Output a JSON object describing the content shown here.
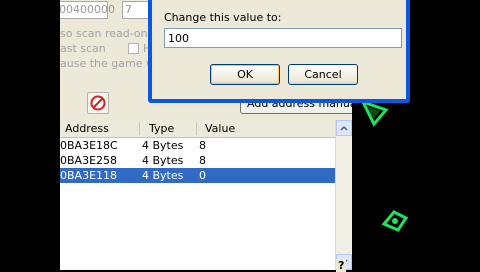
{
  "window": {
    "address_field_value": "00400000",
    "small_field_value": "7",
    "option_scan_readonly": "so scan read-only m",
    "option_fast_scan": "ast scan",
    "option_fast_scan_hex": "H",
    "option_pause_game": "ause the game whil",
    "add_address_manually_label": "Add address manually"
  },
  "table": {
    "columns": [
      "Address",
      "Type",
      "Value"
    ],
    "rows": [
      {
        "address": "0BA3E18C",
        "type": "4 Bytes",
        "value": "8",
        "selected": false
      },
      {
        "address": "0BA3E258",
        "type": "4 Bytes",
        "value": "8",
        "selected": false
      },
      {
        "address": "0BA3E118",
        "type": "4 Bytes",
        "value": "0",
        "selected": true
      }
    ],
    "footer_glyph": "?"
  },
  "dialog": {
    "prompt": "Change this value to:",
    "value": "100",
    "ok_label": "OK",
    "cancel_label": "Cancel"
  },
  "colors": {
    "selection": "#316ac5",
    "dialog_frame": "#0a57e0",
    "background_game": "#000000",
    "sprite_green": "#1fe35a"
  }
}
